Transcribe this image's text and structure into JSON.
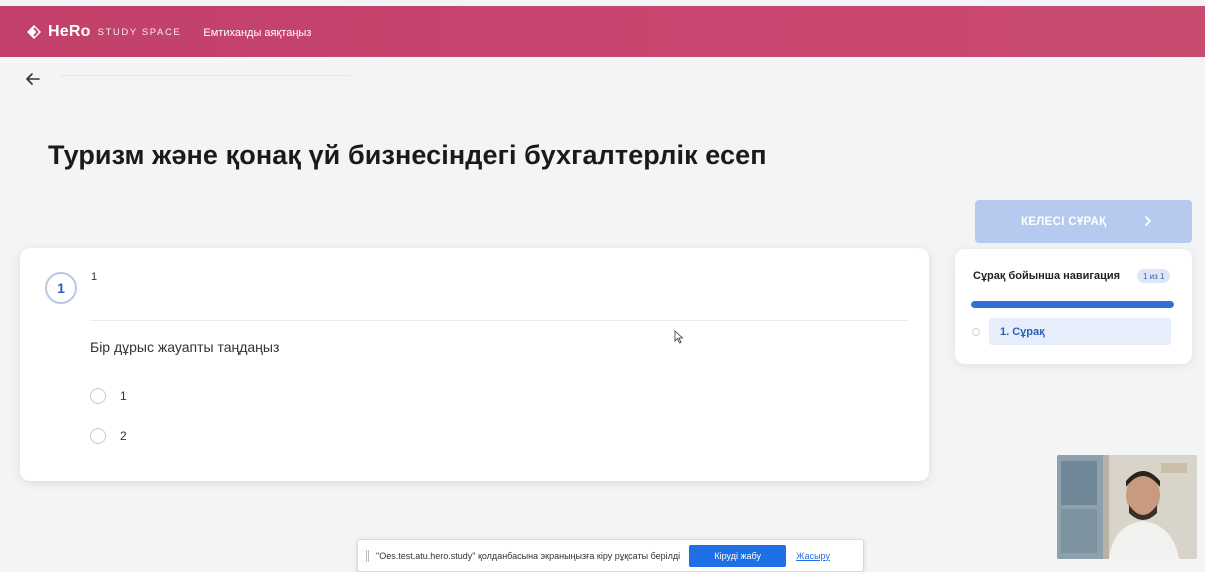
{
  "header": {
    "brand": "HeRo",
    "brand_sub": "STUDY SPACE",
    "finish_exam_label": "Емтиханды аяқтаңыз",
    "accent_color": "#c8466f"
  },
  "page": {
    "title": "Туризм және қонақ үй бизнесіндегі бухгалтерлік есеп",
    "back_icon": "arrow-left-icon"
  },
  "question": {
    "number": "1",
    "text": "1",
    "instruction": "Бір дұрыс жауапты таңдаңыз",
    "options": [
      {
        "label": "1",
        "selected": false
      },
      {
        "label": "2",
        "selected": false
      }
    ]
  },
  "sidebar": {
    "next_button_label": "КЕЛЕСІ СҰРАҚ",
    "next_icon": "chevron-right-icon",
    "nav_title": "Сұрақ бойынша навигация",
    "nav_badge": "1 из 1",
    "progress": 1.0,
    "items": [
      {
        "label": "1. Сұрақ",
        "active": true
      }
    ]
  },
  "screen_share": {
    "message": "\"Oes.test.atu.hero.study\" қолданбасына экраныңызға кіру рұқсаты берілді",
    "stop_label": "Кіруді жабу",
    "hide_label": "Жасыру"
  },
  "colors": {
    "primary": "#2b5fb4",
    "next_button_bg": "#b6c9ef",
    "progress_fill": "#2f6fd6"
  }
}
